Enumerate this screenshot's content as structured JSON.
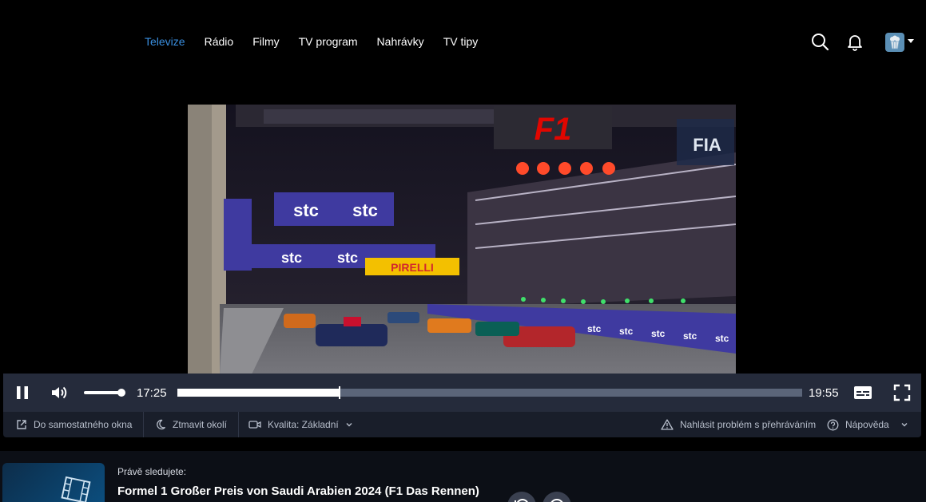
{
  "nav": {
    "items": [
      {
        "label": "Televize",
        "active": true
      },
      {
        "label": "Rádio",
        "active": false
      },
      {
        "label": "Filmy",
        "active": false
      },
      {
        "label": "TV program",
        "active": false
      },
      {
        "label": "Nahrávky",
        "active": false
      },
      {
        "label": "TV tipy",
        "active": false
      }
    ],
    "icons": [
      "search-icon",
      "bell-icon",
      "avatar",
      "caret-down-icon"
    ]
  },
  "player": {
    "current_time": "17:25",
    "end_time": "19:55",
    "progress": 0.26,
    "volume": 0.9,
    "icons": [
      "pause-icon",
      "volume-icon",
      "subtitles-icon",
      "fullscreen-icon"
    ]
  },
  "subbar": {
    "popout": "Do samostatného okna",
    "dim": "Ztmavit okolí",
    "quality": "Kvalita: Základní",
    "report": "Nahlásit problém s přehráváním",
    "help": "Nápověda"
  },
  "now_watching": {
    "label": "Právě sledujete:",
    "title": "Formel 1 Großer Preis von Saudi Arabien 2024 (F1 Das Rennen)"
  },
  "colors": {
    "accent": "#3a8fe0",
    "control_bar": "#252b3b",
    "sub_bar": "#191e2a",
    "seek_track": "#5b6579"
  }
}
